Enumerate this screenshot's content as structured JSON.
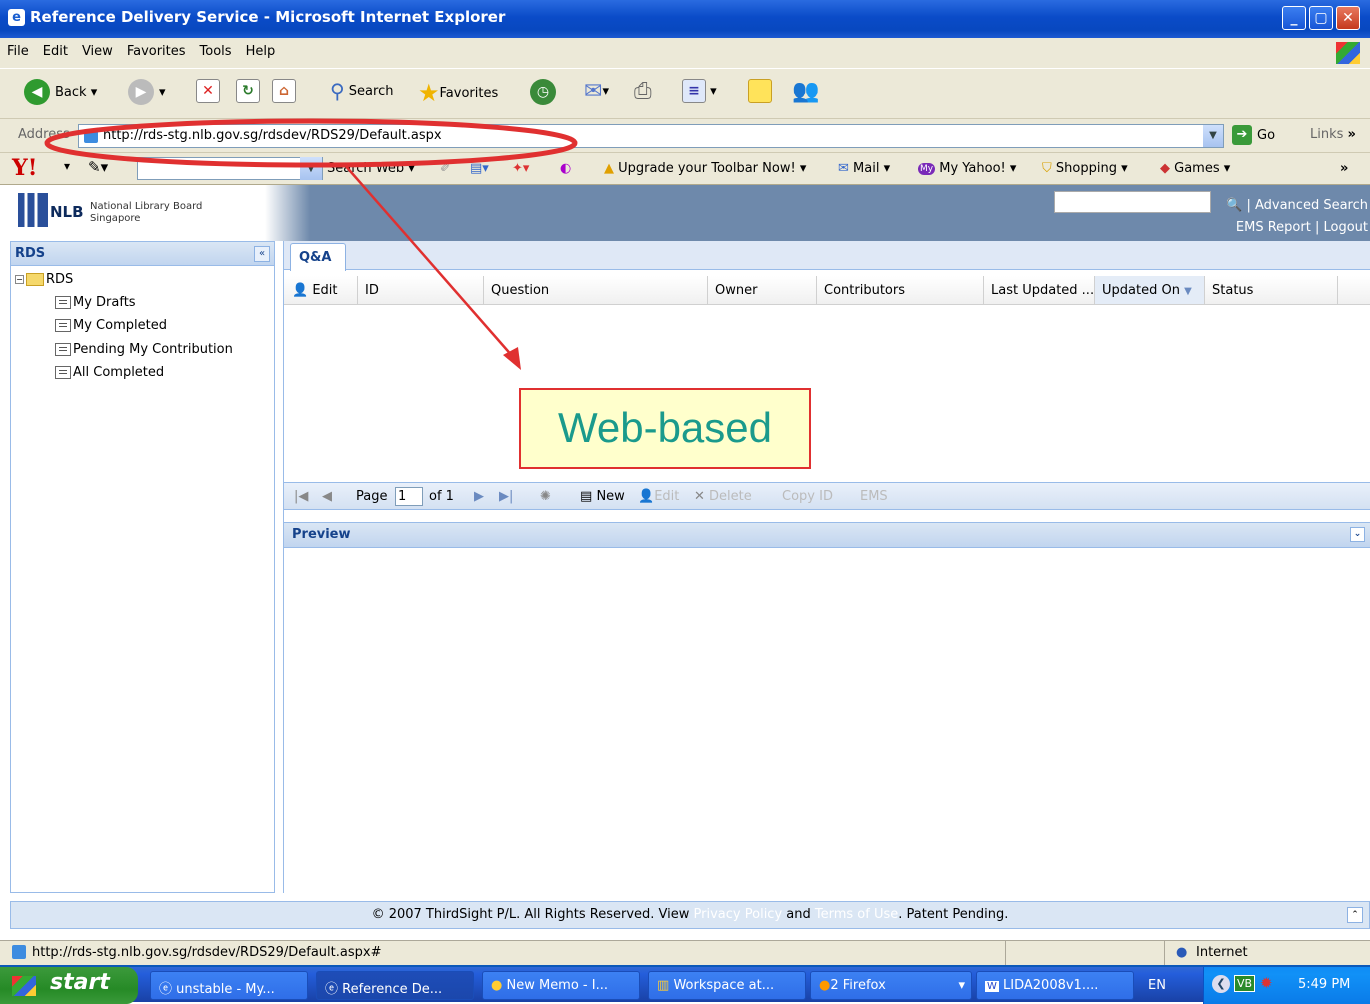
{
  "window": {
    "title": "Reference Delivery Service - Microsoft Internet Explorer"
  },
  "menu": [
    "File",
    "Edit",
    "View",
    "Favorites",
    "Tools",
    "Help"
  ],
  "toolbar": {
    "back": "Back",
    "search": "Search",
    "favorites": "Favorites"
  },
  "address": {
    "label": "Address",
    "url": "http://rds-stg.nlb.gov.sg/rdsdev/RDS29/Default.aspx",
    "go": "Go",
    "links": "Links"
  },
  "yahoo": {
    "search_web": "Search Web",
    "upgrade": "Upgrade your Toolbar Now!",
    "mail": "Mail",
    "my_yahoo": "My Yahoo!",
    "shopping": "Shopping",
    "games": "Games"
  },
  "site": {
    "logo_text": "NLB",
    "org_line1": "National Library Board",
    "org_line2": "Singapore",
    "advanced_search": "| Advanced Search",
    "ems_report": "EMS Report",
    "logout": "Logout"
  },
  "left_panel": {
    "title": "RDS",
    "root": "RDS",
    "items": [
      "My Drafts",
      "My Completed",
      "Pending My Contribution",
      "All Completed"
    ]
  },
  "main": {
    "tab": "Q&A",
    "columns": [
      "Edit",
      "ID",
      "Question",
      "Owner",
      "Contributors",
      "Last Updated ...",
      "Updated On",
      "Status"
    ],
    "pager": {
      "page_label": "Page",
      "page_value": "1",
      "of_label": "of 1",
      "new": "New",
      "edit": "Edit",
      "delete": "Delete",
      "copy_id": "Copy ID",
      "ems": "EMS"
    },
    "preview_title": "Preview"
  },
  "footer": {
    "prefix": "© 2007 ThirdSight P/L. All Rights Reserved. View ",
    "privacy": "Privacy Policy",
    "and": " and ",
    "terms": "Terms of Use",
    "suffix": ". Patent Pending."
  },
  "status": {
    "url": "http://rds-stg.nlb.gov.sg/rdsdev/RDS29/Default.aspx#",
    "zone": "Internet"
  },
  "taskbar": {
    "start": "start",
    "tasks": [
      "unstable - My...",
      "Reference De...",
      "New Memo - I...",
      "Workspace at...",
      "2 Firefox",
      "LIDA2008v1....",
      "EN"
    ],
    "clock": "5:49 PM"
  },
  "annotation": {
    "callout": "Web-based",
    "accent": "#e03030"
  }
}
